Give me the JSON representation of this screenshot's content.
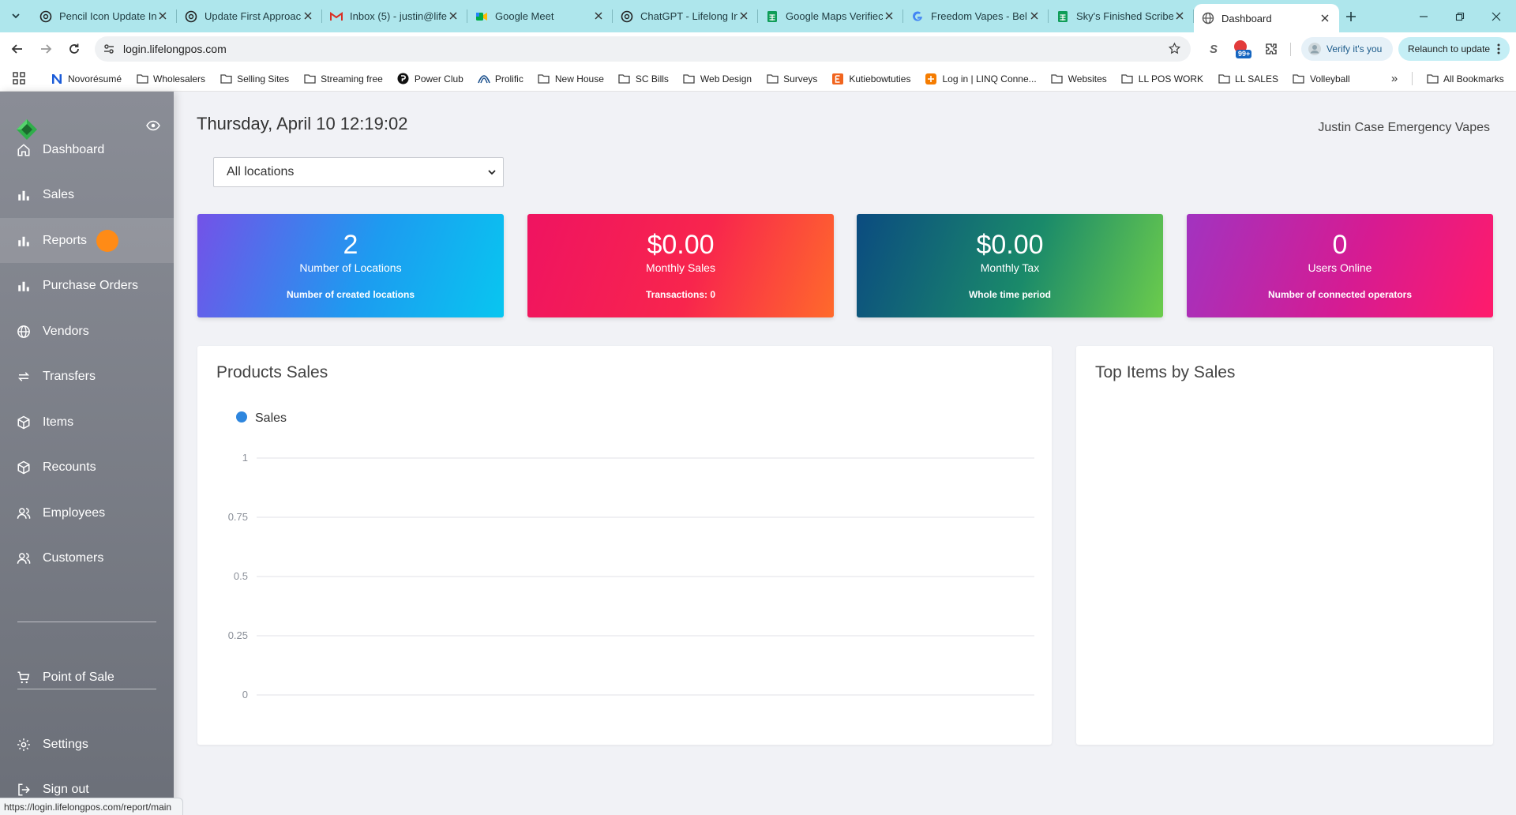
{
  "browser": {
    "tabs": [
      {
        "title": "Pencil Icon Update In",
        "icon": "chatgpt-icon"
      },
      {
        "title": "Update First Approac",
        "icon": "chatgpt-icon"
      },
      {
        "title": "Inbox (5) - justin@life",
        "icon": "gmail-icon"
      },
      {
        "title": "Google Meet",
        "icon": "meet-icon"
      },
      {
        "title": "ChatGPT - Lifelong In",
        "icon": "chatgpt-icon"
      },
      {
        "title": "Google Maps Verifiec",
        "icon": "sheets-icon"
      },
      {
        "title": "Freedom Vapes - Bel",
        "icon": "google-icon"
      },
      {
        "title": "Sky's Finished Scriber",
        "icon": "sheets-icon"
      },
      {
        "title": "Dashboard",
        "icon": "globe-icon",
        "active": true
      }
    ],
    "url": "login.lifelongpos.com",
    "verify_label": "Verify it's you",
    "relaunch_label": "Relaunch to update",
    "extension_badge": "99+",
    "bookmarks": [
      {
        "label": "Novorésumé",
        "icon": "novoresume-icon"
      },
      {
        "label": "Wholesalers",
        "icon": "folder-icon"
      },
      {
        "label": "Selling Sites",
        "icon": "folder-icon"
      },
      {
        "label": "Streaming free",
        "icon": "folder-icon"
      },
      {
        "label": "Power Club",
        "icon": "powerclub-icon"
      },
      {
        "label": "Prolific",
        "icon": "prolific-icon"
      },
      {
        "label": "New House",
        "icon": "folder-icon"
      },
      {
        "label": "SC Bills",
        "icon": "folder-icon"
      },
      {
        "label": "Web Design",
        "icon": "folder-icon"
      },
      {
        "label": "Surveys",
        "icon": "folder-icon"
      },
      {
        "label": "Kutiebowtuties",
        "icon": "etsy-icon"
      },
      {
        "label": "Log in | LINQ Conne...",
        "icon": "linq-icon"
      },
      {
        "label": "Websites",
        "icon": "folder-icon"
      },
      {
        "label": "LL POS WORK",
        "icon": "folder-icon"
      },
      {
        "label": "LL SALES",
        "icon": "folder-icon"
      },
      {
        "label": "Volleyball",
        "icon": "folder-icon"
      }
    ],
    "all_bookmarks_label": "All Bookmarks",
    "status_url": "https://login.lifelongpos.com/report/main"
  },
  "sidebar": {
    "items": [
      {
        "label": "Dashboard",
        "icon": "home-icon"
      },
      {
        "label": "Sales",
        "icon": "bar-chart-icon"
      },
      {
        "label": "Reports",
        "icon": "bar-chart-icon",
        "active": true
      },
      {
        "label": "Purchase Orders",
        "icon": "bar-chart-icon"
      },
      {
        "label": "Vendors",
        "icon": "globe-icon"
      },
      {
        "label": "Transfers",
        "icon": "transfer-icon"
      },
      {
        "label": "Items",
        "icon": "box-icon"
      },
      {
        "label": "Recounts",
        "icon": "box-icon"
      },
      {
        "label": "Employees",
        "icon": "users-icon"
      },
      {
        "label": "Customers",
        "icon": "users-icon"
      }
    ],
    "pos": {
      "label": "Point of Sale",
      "icon": "cart-icon"
    },
    "settings": {
      "label": "Settings",
      "icon": "gear-icon"
    },
    "signout": {
      "label": "Sign out",
      "icon": "sign-out-icon"
    }
  },
  "header": {
    "datetime": "Thursday, April 10 12:19:02",
    "company": "Justin Case Emergency Vapes"
  },
  "location_filter": {
    "selected": "All locations"
  },
  "stats": [
    {
      "value": "2",
      "label": "Number of Locations",
      "sub": "Number of created locations"
    },
    {
      "value": "$0.00",
      "label": "Monthly Sales",
      "sub": "Transactions: 0"
    },
    {
      "value": "$0.00",
      "label": "Monthly Tax",
      "sub": "Whole time period"
    },
    {
      "value": "0",
      "label": "Users Online",
      "sub": "Number of connected operators"
    }
  ],
  "products_card": {
    "title": "Products Sales"
  },
  "top_items_card": {
    "title": "Top Items by Sales"
  },
  "chart_data": {
    "type": "line",
    "series": [
      {
        "name": "Sales",
        "values": [],
        "color": "#2e86de"
      }
    ],
    "y_ticks": [
      "1",
      "0.75",
      "0.5",
      "0.25",
      "0"
    ],
    "ylim": [
      0,
      1
    ],
    "grid": true,
    "legend": "top-left"
  }
}
